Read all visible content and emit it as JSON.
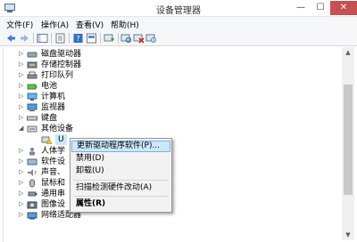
{
  "window": {
    "title": "设备管理器",
    "minimize_glyph": "—",
    "maximize_glyph": "☐",
    "close_glyph": "✕"
  },
  "menu": [
    {
      "label": "文件(F)"
    },
    {
      "label": "操作(A)"
    },
    {
      "label": "查看(V)"
    },
    {
      "label": "帮助(H)"
    }
  ],
  "toolbar_icons": [
    "back-icon",
    "forward-icon",
    "console-tree-icon",
    "properties-icon",
    "help-icon",
    "show-hide-icon",
    "update-driver-icon",
    "scan-hardware-icon",
    "uninstall-icon",
    "disable-icon"
  ],
  "tree": {
    "rows": [
      {
        "label": "磁盘驱动器",
        "icon": "disk-drive-icon",
        "arrow": "▷"
      },
      {
        "label": "存储控制器",
        "icon": "storage-controller-icon",
        "arrow": "▷"
      },
      {
        "label": "打印队列",
        "icon": "print-queue-icon",
        "arrow": "▷"
      },
      {
        "label": "电池",
        "icon": "battery-icon",
        "arrow": "▷"
      },
      {
        "label": "计算机",
        "icon": "computer-icon",
        "arrow": "▷"
      },
      {
        "label": "监视器",
        "icon": "monitor-icon",
        "arrow": "▷"
      },
      {
        "label": "键盘",
        "icon": "keyboard-icon",
        "arrow": "▷"
      },
      {
        "label": "其他设备",
        "icon": "other-devices-icon",
        "arrow": "◢"
      },
      {
        "label": "U",
        "icon": "unknown-device-warning-icon",
        "arrow": ""
      },
      {
        "label": "人体学",
        "icon": "hid-icon",
        "arrow": "▷"
      },
      {
        "label": "软件设",
        "icon": "software-device-icon",
        "arrow": "▷"
      },
      {
        "label": "声音、",
        "icon": "sound-icon",
        "arrow": "▷"
      },
      {
        "label": "鼠标和",
        "icon": "mouse-icon",
        "arrow": "▷"
      },
      {
        "label": "通用串",
        "icon": "usb-icon",
        "arrow": "▷"
      },
      {
        "label": "图像设",
        "icon": "imaging-icon",
        "arrow": "▷"
      },
      {
        "label": "网络适配器",
        "icon": "network-adapter-icon",
        "arrow": "▷"
      }
    ]
  },
  "context_menu": {
    "items": [
      {
        "label": "更新驱动程序软件(P)...",
        "highlighted": true,
        "bold": false
      },
      {
        "label": "禁用(D)",
        "highlighted": false,
        "bold": false
      },
      {
        "label": "卸载(U)",
        "highlighted": false,
        "bold": false
      },
      {
        "label": "扫描检测硬件改动(A)",
        "highlighted": false,
        "bold": false
      },
      {
        "label": "属性(R)",
        "highlighted": false,
        "bold": true
      }
    ]
  },
  "scrollbar": {
    "up_glyph": "▲",
    "down_glyph": "▼"
  },
  "colors": {
    "highlight": "#cde8fc",
    "highlight_border": "#78aee5",
    "close_button": "#c75050"
  }
}
